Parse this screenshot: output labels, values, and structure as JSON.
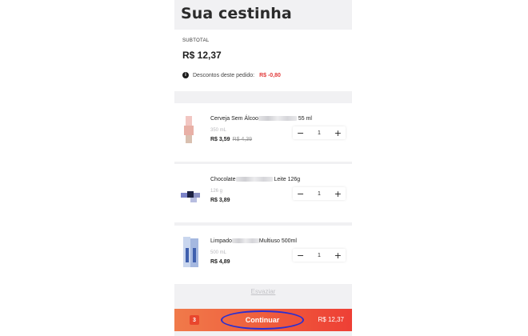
{
  "page": {
    "title": "Sua cestinha"
  },
  "summary": {
    "subtotal_label": "SUBTOTAL",
    "subtotal_value": "R$ 12,37",
    "discount_label": "Descontos deste pedido:",
    "discount_value": "R$ -0,80"
  },
  "items": [
    {
      "name_prefix": "Cerveja Sem Álcoo",
      "name_suffix": "55 ml",
      "size": "350 mL",
      "price": "R$ 3,59",
      "old_price": "R$ 4,39",
      "quantity": "1"
    },
    {
      "name_prefix": "Chocolate",
      "name_suffix": "Leite 126g",
      "size": "126 g",
      "price": "R$ 3,89",
      "old_price": "",
      "quantity": "1"
    },
    {
      "name_prefix": "Limpado",
      "name_suffix": "Multiuso 500ml",
      "size": "500 mL",
      "price": "R$ 4,89",
      "old_price": "",
      "quantity": "1"
    }
  ],
  "stepper": {
    "minus": "−",
    "plus": "+"
  },
  "clear_label": "Esvaziar",
  "bottom_bar": {
    "count": "3",
    "continue_label": "Continuar",
    "total": "R$ 12,37"
  },
  "colors": {
    "accent": "#ef5b3c",
    "discount": "#e23b3b",
    "highlight_ring": "#2b2fd1"
  }
}
